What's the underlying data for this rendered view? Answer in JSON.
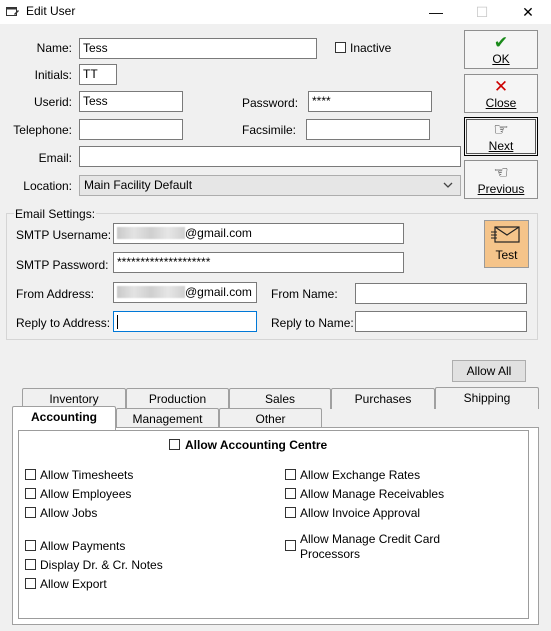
{
  "window": {
    "title": "Edit User",
    "minimize": "—",
    "maximize": "☐",
    "close": "✕"
  },
  "form": {
    "name_label": "Name:",
    "name_value": "Tess",
    "inactive_label": "Inactive",
    "initials_label": "Initials:",
    "initials_value": "TT",
    "userid_label": "Userid:",
    "userid_value": "Tess",
    "password_label": "Password:",
    "password_value": "****",
    "telephone_label": "Telephone:",
    "telephone_value": "",
    "facsimile_label": "Facsimile:",
    "facsimile_value": "",
    "email_label": "Email:",
    "email_value": "",
    "location_label": "Location:",
    "location_value": "Main Facility Default"
  },
  "side_buttons": {
    "ok": "OK",
    "close": "Close",
    "next": "Next",
    "previous": "Previous"
  },
  "email_settings": {
    "legend": "Email Settings:",
    "smtp_username_label": "SMTP Username:",
    "smtp_username_suffix": "@gmail.com",
    "smtp_password_label": "SMTP Password:",
    "smtp_password_value": "********************",
    "from_address_label": "From Address:",
    "from_address_suffix": "@gmail.com",
    "from_name_label": "From Name:",
    "from_name_value": "",
    "reply_address_label": "Reply to Address:",
    "reply_address_value": "",
    "reply_name_label": "Reply to Name:",
    "reply_name_value": "",
    "test_label": "Test"
  },
  "allow_all_label": "Allow All",
  "tabs_back": [
    "Inventory",
    "Production",
    "Sales",
    "Purchases",
    "Shipping"
  ],
  "tabs_front": [
    "Accounting",
    "Management",
    "Other"
  ],
  "accounting": {
    "centre_label": "Allow Accounting Centre",
    "left": [
      "Allow Timesheets",
      "Allow Employees",
      "Allow Jobs",
      "Allow Payments",
      "Display Dr. & Cr. Notes",
      "Allow Export"
    ],
    "right": [
      "Allow Exchange Rates",
      "Allow Manage Receivables",
      "Allow Invoice Approval",
      "Allow Manage Credit Card Processors"
    ]
  },
  "colors": {
    "test_button": "#f5c48a",
    "ok_check": "#1a8a1a",
    "close_x": "#cc0000",
    "focus_border": "#0078d7"
  }
}
